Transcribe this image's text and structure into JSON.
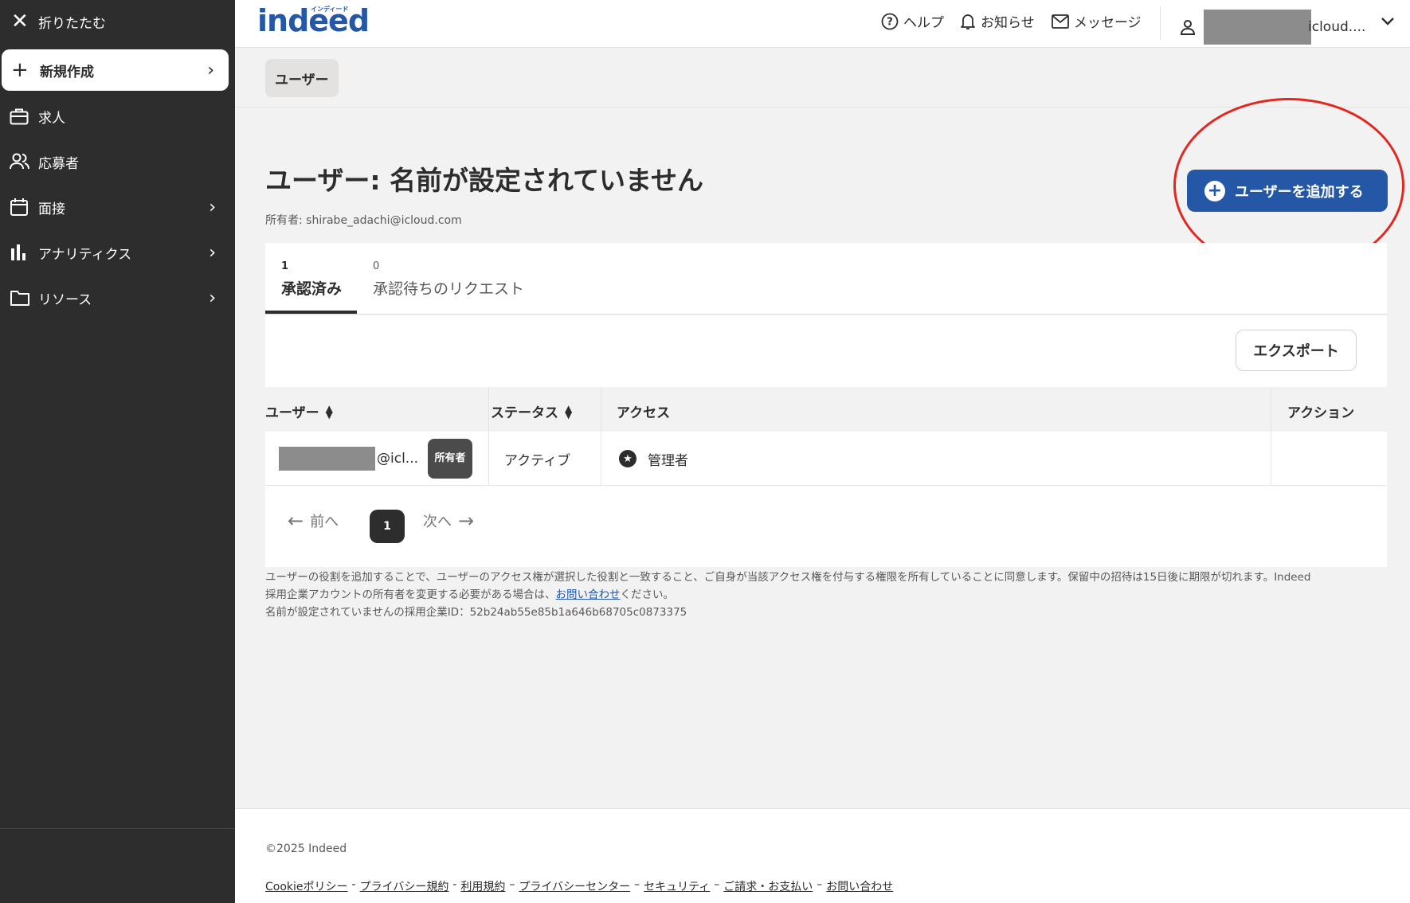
{
  "sidebar": {
    "collapse_label": "折りたたむ",
    "new_label": "新規作成",
    "items": [
      {
        "label": "求人"
      },
      {
        "label": "応募者"
      },
      {
        "label": "面接"
      },
      {
        "label": "アナリティクス"
      },
      {
        "label": "リソース"
      }
    ]
  },
  "header": {
    "logo_text": "indeed",
    "logo_kana": "インディード",
    "help_label": "ヘルプ",
    "notifications_label": "お知らせ",
    "messages_label": "メッセージ",
    "account_label": "icloud...."
  },
  "breadcrumb": {
    "label": "ユーザー"
  },
  "page": {
    "title": "ユーザー: 名前が設定されていません",
    "owner_line": "所有者: shirabe_adachi@icloud.com",
    "add_user_label": "ユーザーを追加する"
  },
  "tabs": [
    {
      "count": "1",
      "label": "承認済み"
    },
    {
      "count": "0",
      "label": "承認待ちのリクエスト"
    }
  ],
  "toolbar": {
    "export_label": "エクスポート"
  },
  "table": {
    "headers": {
      "user": "ユーザー",
      "status": "ステータス",
      "access": "アクセス",
      "action": "アクション"
    },
    "rows": [
      {
        "user_suffix": "@icl...",
        "badge": "所有者",
        "status": "アクティブ",
        "access": "管理者"
      }
    ]
  },
  "pager": {
    "prev_label": "前へ",
    "page": "1",
    "next_label": "次へ"
  },
  "disclaimer": {
    "line1": "ユーザーの役割を追加することで、ユーザーのアクセス権が選択した役割と一致すること、ご自身が当該アクセス権を付与する権限を所有していることに同意します。保留中の招待は15日後に期限が切れます。Indeed",
    "line2_pre": "採用企業アカウントの所有者を変更する必要がある場合は、",
    "line2_link": "お問い合わせ",
    "line2_post": "ください。",
    "line3": "名前が設定されていませんの採用企業ID：52b24ab55e85b1a646b68705c0873375"
  },
  "footer": {
    "copyright": "©2025 Indeed",
    "links": [
      "Cookieポリシー",
      "プライバシー規約",
      "利用規約",
      "プライバシーセンター",
      "セキュリティ",
      "ご請求・お支払い",
      "お問い合わせ"
    ],
    "seps": [
      "-",
      "-",
      "–",
      "–",
      "–",
      "–"
    ]
  },
  "colors": {
    "brand_blue": "#2557a7",
    "sidebar_bg": "#2d2d2d",
    "highlight_red": "#e3271f"
  }
}
